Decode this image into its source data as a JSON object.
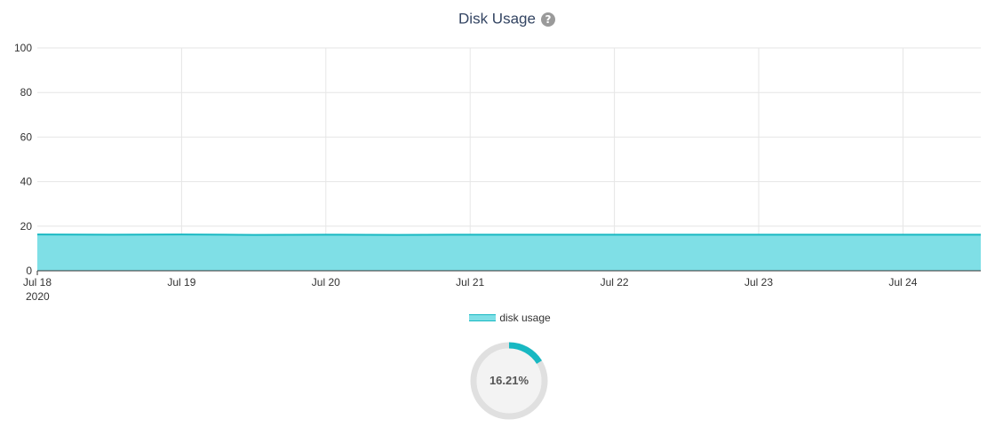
{
  "header": {
    "title": "Disk Usage",
    "help_icon": "question-circle-icon"
  },
  "chart_data": {
    "type": "area",
    "x": [
      "2020-07-18",
      "2020-07-18T12:00",
      "2020-07-19",
      "2020-07-19T12:00",
      "2020-07-20",
      "2020-07-20T12:00",
      "2020-07-21",
      "2020-07-21T12:00",
      "2020-07-22",
      "2020-07-22T12:00",
      "2020-07-23",
      "2020-07-23T12:00",
      "2020-07-24",
      "2020-07-24T12:00"
    ],
    "series": [
      {
        "name": "disk usage",
        "values": [
          16.3,
          16.2,
          16.3,
          16.1,
          16.2,
          16.1,
          16.2,
          16.2,
          16.2,
          16.2,
          16.2,
          16.2,
          16.2,
          16.2
        ],
        "fill_color": "#7fdfe6",
        "line_color": "#18b8c2"
      }
    ],
    "ylim": [
      0,
      100
    ],
    "yticks": [
      "0",
      "20",
      "40",
      "60",
      "80",
      "100"
    ],
    "xticks": [
      "Jul 18",
      "Jul 19",
      "Jul 20",
      "Jul 21",
      "Jul 22",
      "Jul 23",
      "Jul 24"
    ],
    "xticks_sub": [
      "2020",
      "",
      "",
      "",
      "",
      "",
      ""
    ],
    "grid": true,
    "legend": "bottom-center"
  },
  "gauge": {
    "value_text": "16.21%",
    "fraction": 0.1621,
    "color": "#18b8c2",
    "track_color": "#e0e0e0"
  }
}
